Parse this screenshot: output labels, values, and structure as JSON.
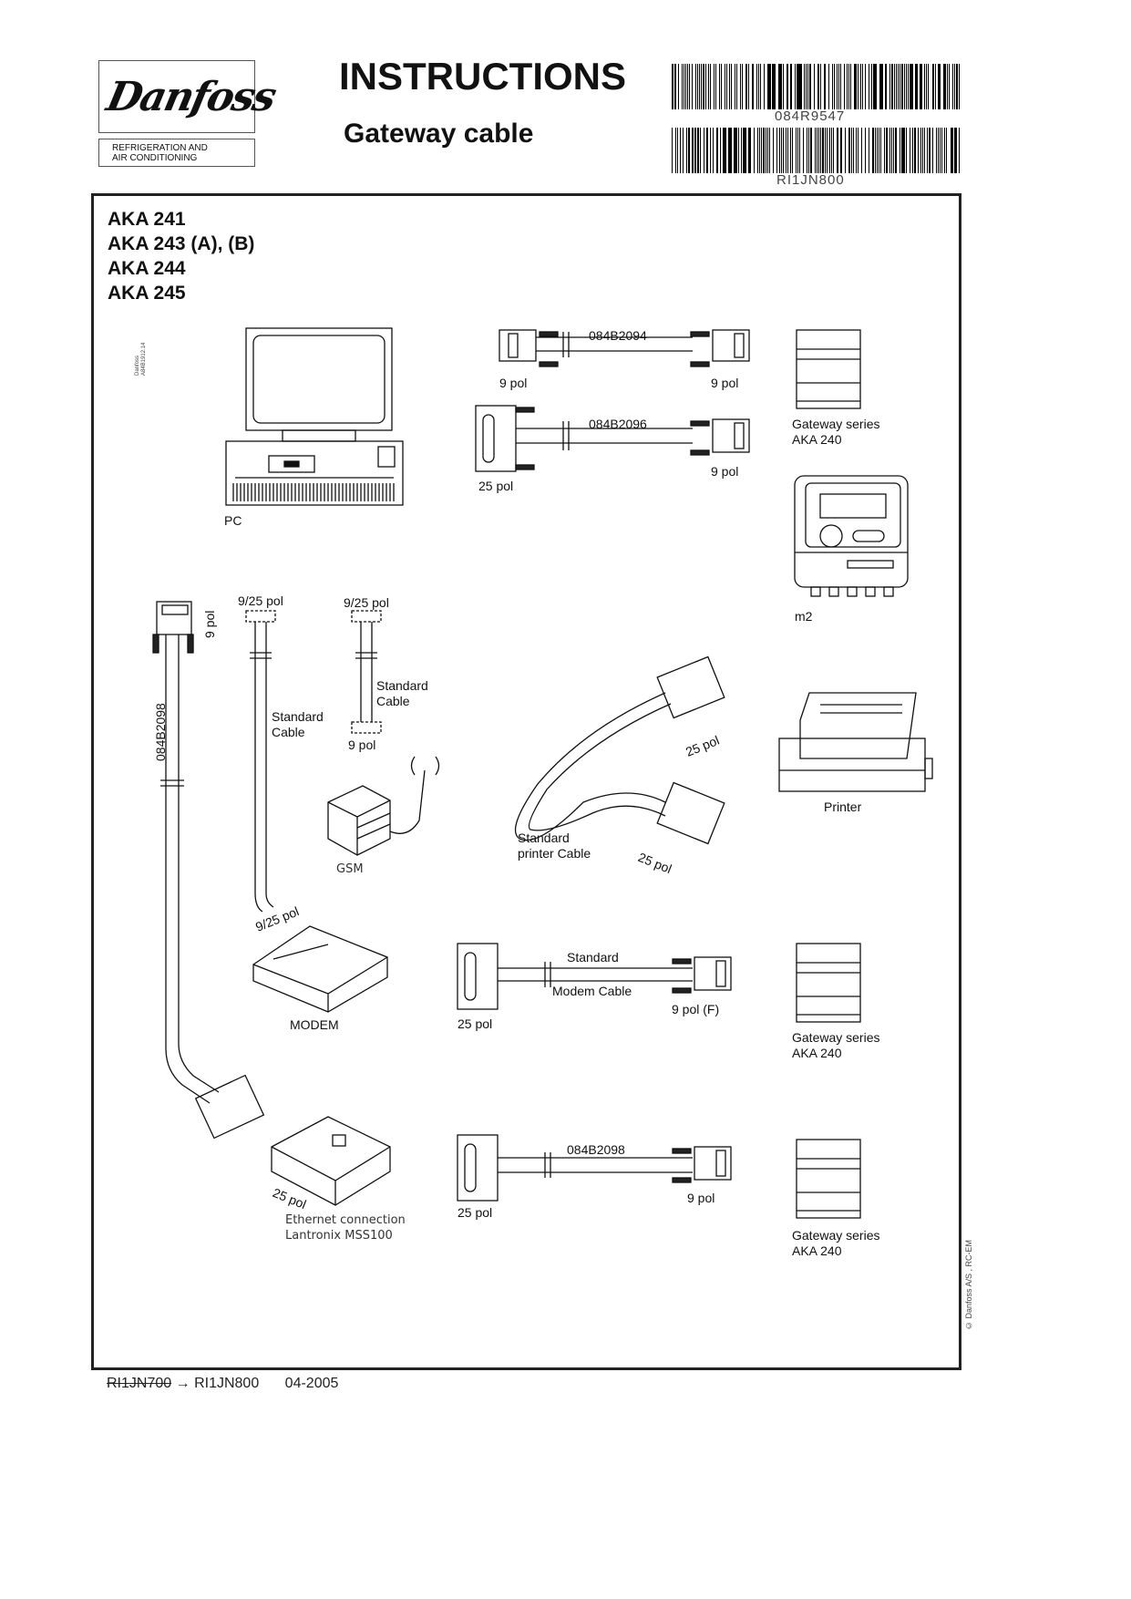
{
  "header": {
    "brand": "Danfoss",
    "brand_subtitle_line1": "REFRIGERATION AND",
    "brand_subtitle_line2": "AIR CONDITIONING",
    "title": "INSTRUCTIONS",
    "subtitle": "Gateway cable",
    "barcode1_text": "084R9547",
    "barcode2_text": "RI1JN800"
  },
  "models": [
    "AKA 241",
    "AKA 243 (A), (B)",
    "AKA 244",
    "AKA 245"
  ],
  "drawing_ref": [
    "Danfoss",
    "A84B1912.14"
  ],
  "diagram": {
    "pc_label": "PC",
    "cable1": {
      "part": "084B2094",
      "left": "9 pol",
      "right": "9 pol"
    },
    "cable2": {
      "part": "084B2096",
      "left": "25 pol",
      "right": "9 pol"
    },
    "gateway_label_line1": "Gateway series",
    "gateway_label_line2": "AKA 240",
    "m2_label": "m2",
    "vertical_cable": {
      "part": "084B2098",
      "top": "9 pol"
    },
    "std_cable_a": {
      "top": "9/25 pol",
      "label_line1": "Standard",
      "label_line2": "Cable",
      "bottom": "9/25 pol"
    },
    "std_cable_b": {
      "top": "9/25 pol",
      "label_line1": "Standard",
      "label_line2": "Cable",
      "bottom": "9 pol"
    },
    "gsm_label": "GSM",
    "printer_cable": {
      "label_line1": "Standard",
      "label_line2": "printer Cable",
      "end1": "25 pol",
      "end2": "25 pol"
    },
    "printer_label": "Printer",
    "modem_label": "MODEM",
    "modem_cable": {
      "label_line1": "Standard",
      "label_line2": "Modem Cable",
      "left": "25 pol",
      "right": "9 pol (F)"
    },
    "ethernet_cable": {
      "part": "084B2098",
      "left": "25 pol",
      "right": "9 pol"
    },
    "ethernet_end": "25 pol",
    "ethernet_line1": "Ethernet connection",
    "ethernet_line2": "Lantronix MSS100"
  },
  "footer": {
    "old_code": "RI1JN700",
    "arrow": "→",
    "new_code": "RI1JN800",
    "date": "04-2005",
    "copyright": "© Danfoss A/S , RC-EM"
  }
}
